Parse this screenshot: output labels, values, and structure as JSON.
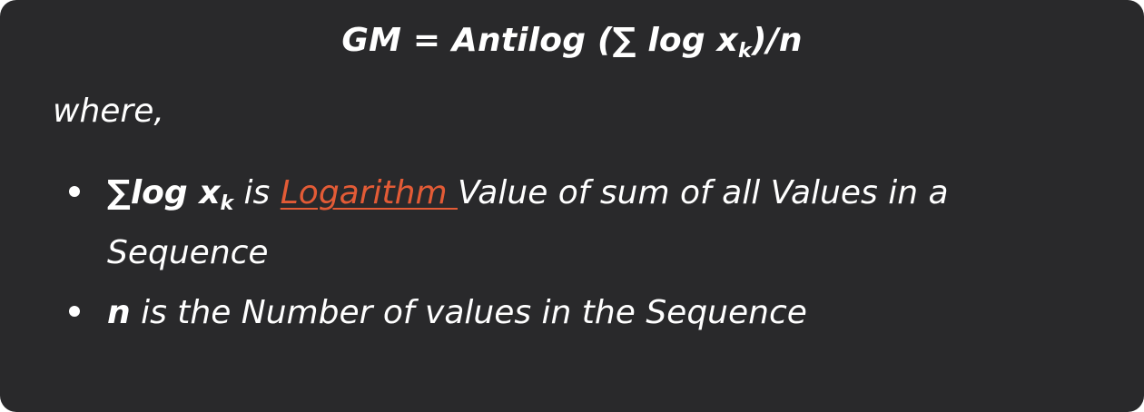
{
  "formula": {
    "main": "GM = Antilog (∑ log x",
    "sub": "k",
    "tail": ")/n"
  },
  "where_label": "where,",
  "bullets": [
    {
      "term": "∑log x",
      "term_sub": "k",
      "text_before": " is ",
      "link": "Logarithm ",
      "text_after": "Value of sum of all Values in a Sequence"
    },
    {
      "term": "n",
      "text": " is the Number of values in the Sequence"
    }
  ],
  "colors": {
    "background": "#29292b",
    "text": "#ffffff",
    "link": "#e35b36"
  }
}
